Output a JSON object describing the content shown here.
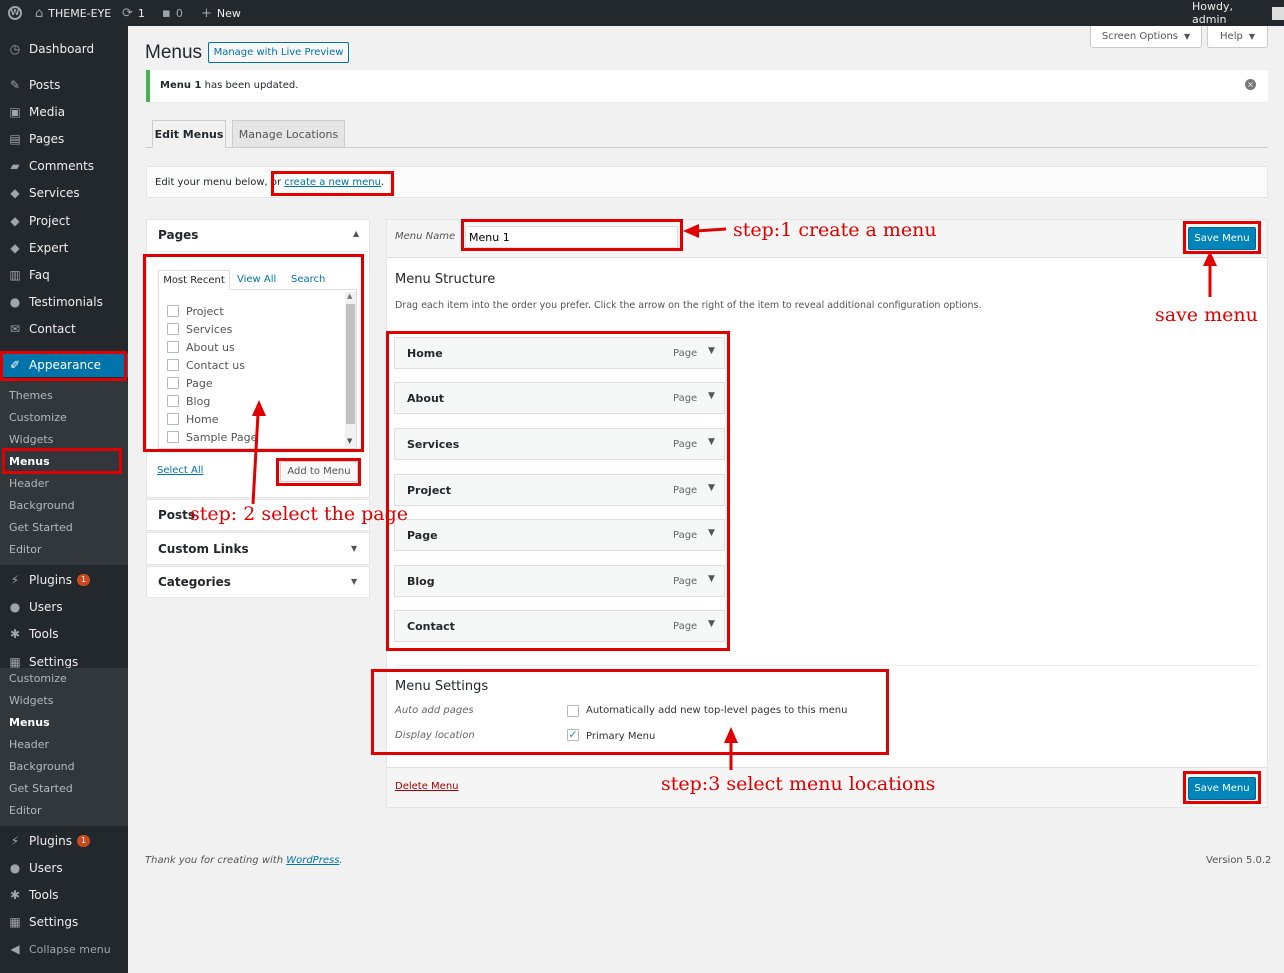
{
  "admin_bar": {
    "site_name": "THEME-EYE",
    "updates_count": "1",
    "comments_count": "0",
    "new_label": "New",
    "greeting": "Howdy, admin"
  },
  "sidebar": {
    "items": [
      {
        "label": "Dashboard",
        "icon": "dashboard-icon"
      },
      {
        "label": "Posts",
        "icon": "pin-icon"
      },
      {
        "label": "Media",
        "icon": "media-icon"
      },
      {
        "label": "Pages",
        "icon": "pages-icon"
      },
      {
        "label": "Comments",
        "icon": "comment-icon"
      },
      {
        "label": "Services",
        "icon": "tag-icon"
      },
      {
        "label": "Project",
        "icon": "tag-icon"
      },
      {
        "label": "Expert",
        "icon": "tag-icon"
      },
      {
        "label": "Faq",
        "icon": "document-icon"
      },
      {
        "label": "Testimonials",
        "icon": "users-icon"
      },
      {
        "label": "Contact",
        "icon": "mail-icon"
      },
      {
        "label": "Appearance",
        "icon": "brush-icon"
      }
    ],
    "appearance_sub": [
      "Themes",
      "Customize",
      "Widgets",
      "Menus",
      "Header",
      "Background",
      "Get Started",
      "Editor"
    ],
    "lower": [
      {
        "label": "Plugins",
        "icon": "plugin-icon",
        "badge": "1"
      },
      {
        "label": "Users",
        "icon": "users-icon"
      },
      {
        "label": "Tools",
        "icon": "wrench-icon"
      },
      {
        "label": "Settings",
        "icon": "settings-icon"
      }
    ],
    "settings_sub": [
      "Customize",
      "Widgets",
      "Menus",
      "Header",
      "Background",
      "Get Started",
      "Editor"
    ],
    "lower2": [
      {
        "label": "Plugins",
        "icon": "plugin-icon",
        "badge": "1"
      },
      {
        "label": "Users",
        "icon": "users-icon"
      },
      {
        "label": "Tools",
        "icon": "wrench-icon"
      },
      {
        "label": "Settings",
        "icon": "settings-icon"
      }
    ],
    "collapse": "Collapse menu"
  },
  "header": {
    "title": "Menus",
    "live_preview": "Manage with Live Preview",
    "screen_options": "Screen Options",
    "help": "Help"
  },
  "notice": {
    "menu": "Menu 1",
    "text": " has been updated."
  },
  "tabs": {
    "edit": "Edit Menus",
    "manage": "Manage Locations"
  },
  "edit_bar": {
    "prefix": "Edit your menu below, or ",
    "link": "create a new menu",
    "suffix": "."
  },
  "left_panel": {
    "pages_title": "Pages",
    "tabs": [
      "Most Recent",
      "View All",
      "Search"
    ],
    "pages": [
      "Project",
      "Services",
      "About us",
      "Contact us",
      "Page",
      "Blog",
      "Home",
      "Sample Page"
    ],
    "select_all": "Select All",
    "add_to_menu": "Add to Menu",
    "posts": "Posts",
    "custom_links": "Custom Links",
    "categories": "Categories"
  },
  "menu_editor": {
    "name_label": "Menu Name",
    "name_value": "Menu 1",
    "save": "Save Menu",
    "structure_title": "Menu Structure",
    "structure_desc": "Drag each item into the order you prefer. Click the arrow on the right of the item to reveal additional configuration options.",
    "items": [
      {
        "title": "Home",
        "type": "Page"
      },
      {
        "title": "About",
        "type": "Page"
      },
      {
        "title": "Services",
        "type": "Page"
      },
      {
        "title": "Project",
        "type": "Page"
      },
      {
        "title": "Page",
        "type": "Page"
      },
      {
        "title": "Blog",
        "type": "Page"
      },
      {
        "title": "Contact",
        "type": "Page"
      }
    ],
    "settings_title": "Menu Settings",
    "auto_add_label": "Auto add pages",
    "auto_add_text": "Automatically add new top-level pages to this menu",
    "display_label": "Display location",
    "primary_menu": "Primary Menu",
    "delete": "Delete Menu"
  },
  "annotations": {
    "step1": "step:1 create a menu",
    "step2": "step: 2 select the page",
    "step3": "step:3 select menu locations",
    "save": "save menu"
  },
  "footer": {
    "thanks": "Thank you for creating with ",
    "wp": "WordPress",
    "period": ".",
    "version": "Version 5.0.2"
  },
  "colors": {
    "accent": "#0073aa",
    "annotation": "#e00000",
    "admin_dark": "#23282d"
  }
}
